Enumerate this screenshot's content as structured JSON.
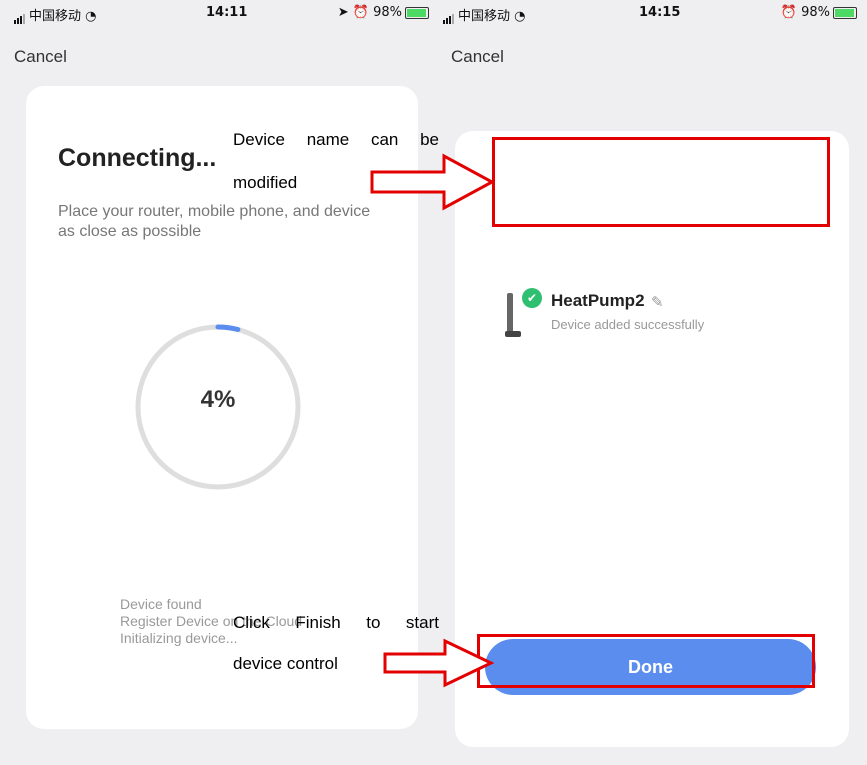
{
  "left_screen": {
    "status": {
      "carrier": "中国移动",
      "time": "14:11",
      "battery": "98%"
    },
    "cancel_label": "Cancel",
    "title": "Connecting...",
    "subtitle": "Place your router, mobile phone, and device as close as possible",
    "progress": {
      "value": 0.04,
      "label": "4%"
    },
    "steps": [
      "Device found",
      "Register Device on the Cloud",
      "Initializing device..."
    ]
  },
  "right_screen": {
    "status": {
      "carrier": "中国移动",
      "time": "14:15",
      "battery": "98%"
    },
    "cancel_label": "Cancel",
    "device": {
      "name": "HeatPump2",
      "status": "Device added successfully"
    },
    "done_label": "Done"
  },
  "annotations": {
    "rename_line1": "Device name can be",
    "rename_line2": "modified",
    "finish_line1": "Click Finish to start",
    "finish_line2": "device control",
    "color": "#e30000"
  },
  "colors": {
    "accent": "#5b8def",
    "success": "#2fbf71",
    "ring_track": "#dedede"
  }
}
